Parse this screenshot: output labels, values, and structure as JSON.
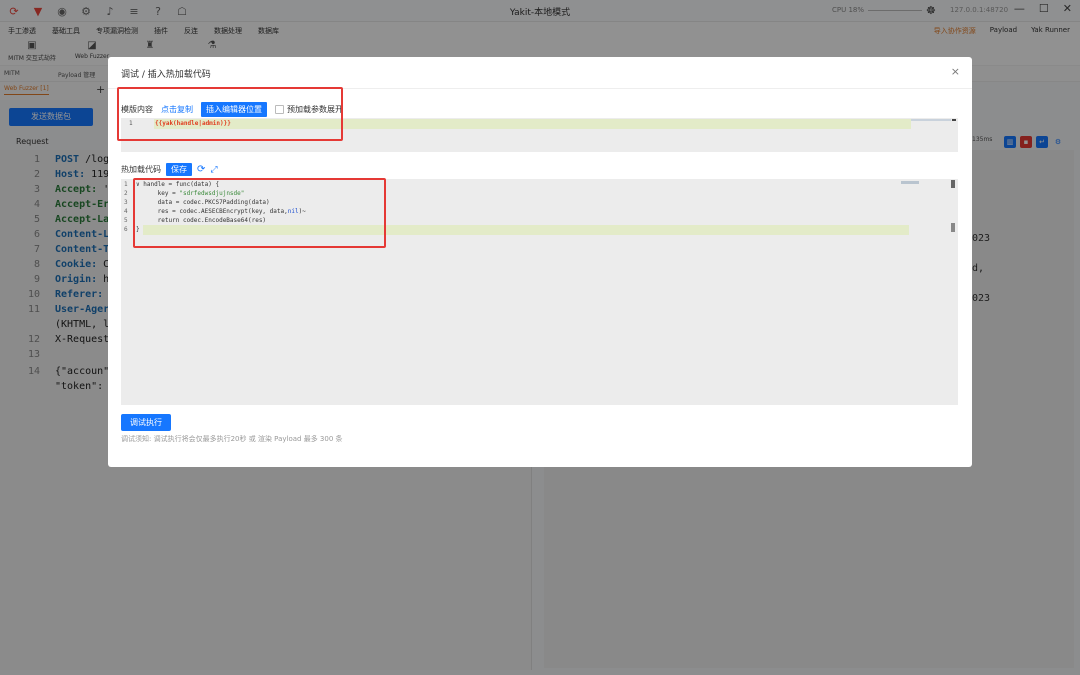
{
  "window": {
    "title": "Yakit-本地模式",
    "cpu_label": "CPU 18%",
    "address": "127.0.0.1:48720"
  },
  "menu": [
    "手工渗透",
    "基础工具",
    "专项漏洞检测",
    "插件",
    "反连",
    "数据处理",
    "数据库"
  ],
  "right_menu": {
    "import": "导入协作资源",
    "payload": "Payload",
    "yak_runner": "Yak Runner"
  },
  "toolbar": [
    {
      "label": "MITM 交互式劫持",
      "icon": "mitm-icon"
    },
    {
      "label": "Web Fuzzer",
      "icon": "fuzzer-icon"
    }
  ],
  "subtabs": [
    "MITM",
    "Payload 管理"
  ],
  "fuzzer_tab": "Web Fuzzer [1]",
  "send_button": "发送数据包",
  "request_label": "Request",
  "request_lines": [
    {
      "n": "1",
      "head": "POST",
      "rest": " /log"
    },
    {
      "n": "2",
      "head": "Host:",
      "rest": " 119"
    },
    {
      "n": "3",
      "head": "Accept:",
      "rest": " '"
    },
    {
      "n": "4",
      "head": "Accept-Er",
      "rest": ""
    },
    {
      "n": "5",
      "head": "Accept-La",
      "rest": ""
    },
    {
      "n": "6",
      "head": "Content-L",
      "rest": ""
    },
    {
      "n": "7",
      "head": "Content-T",
      "rest": ""
    },
    {
      "n": "8",
      "head": "Cookie:",
      "rest": " C"
    },
    {
      "n": "9",
      "head": "Origin:",
      "rest": " h"
    },
    {
      "n": "10",
      "head": "Referer:",
      "rest": ""
    },
    {
      "n": "11",
      "head": "User-Ager",
      "rest": ""
    },
    {
      "n": "",
      "head": "",
      "rest": "(KHTML, l"
    },
    {
      "n": "12",
      "head": "",
      "rest": "X-Request"
    },
    {
      "n": "13",
      "head": "",
      "rest": ""
    },
    {
      "n": "14",
      "head": "",
      "rest": "{\"accoun\""
    },
    {
      "n": "",
      "head": "",
      "rest": "\"token\":"
    }
  ],
  "response": {
    "time": "135ms",
    "lines": [
      "023",
      "d,",
      "023"
    ]
  },
  "modal": {
    "title": "调试 / 插入热加载代码",
    "close": "×",
    "template_label": "模版内容",
    "copy_link": "点击复制",
    "insert_button": "插入编辑器位置",
    "expand_checkbox": "预加载参数展开",
    "template_code": "{{yak(handle|admin)}}",
    "hotload_label": "热加载代码",
    "save_button": "保存",
    "code_lines": [
      {
        "n": "1",
        "text": "handle = func(data) {"
      },
      {
        "n": "2",
        "pre": "      key = ",
        "str": "\"sdrfedwsdjujnsde\""
      },
      {
        "n": "3",
        "text": "      data = codec.PKCS7Padding(data)"
      },
      {
        "n": "4",
        "pre": "      res = codec.AESECBEncrypt(key, data,",
        "nil": "nil",
        "post": ")~"
      },
      {
        "n": "5",
        "text": "      return codec.EncodeBase64(res)"
      },
      {
        "n": "6",
        "text": "}"
      }
    ],
    "run_button": "调试执行",
    "hint": "调试须知: 调试执行将会仅最多执行20秒 或 渲染 Payload 最多 300 条"
  }
}
